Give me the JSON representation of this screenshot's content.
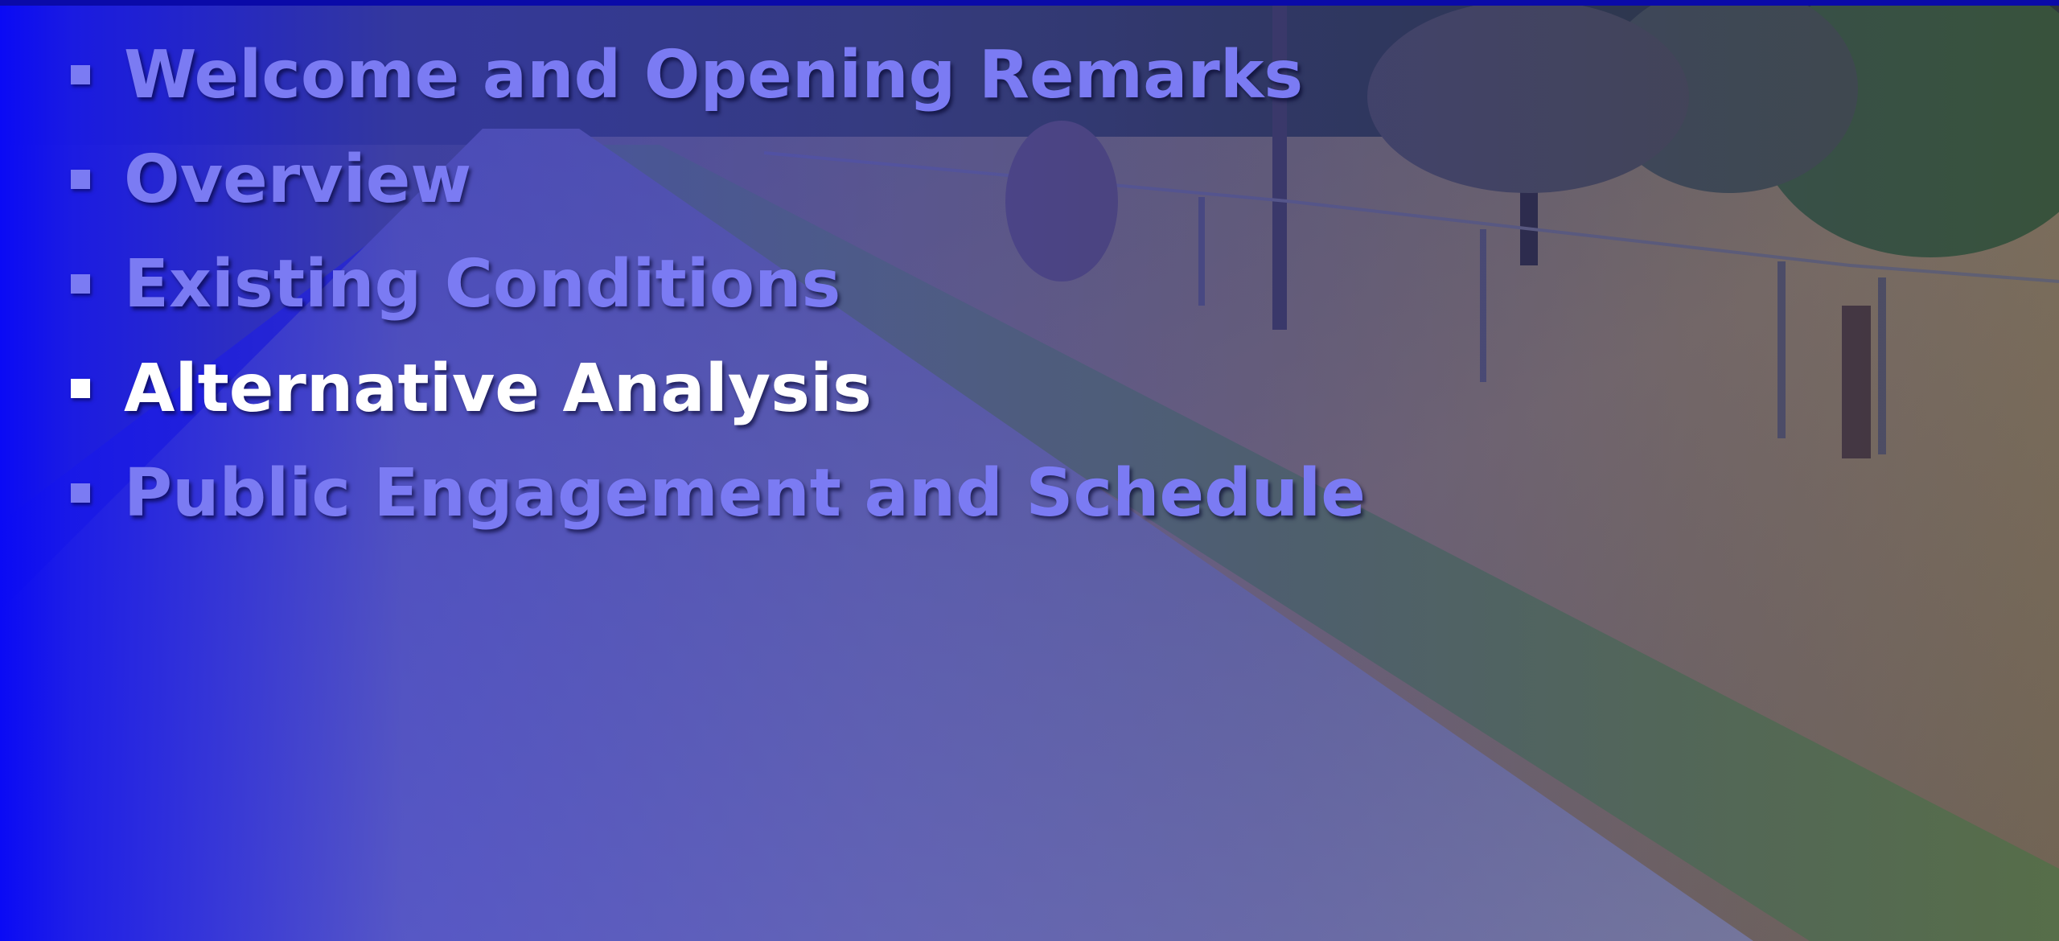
{
  "agenda": {
    "items": [
      {
        "label": "Welcome and Opening Remarks",
        "active": false
      },
      {
        "label": "Overview",
        "active": false
      },
      {
        "label": "Existing Conditions",
        "active": false
      },
      {
        "label": "Alternative Analysis",
        "active": true
      },
      {
        "label": "Public Engagement and Schedule",
        "active": false
      }
    ],
    "active_color": "#ffffff",
    "inactive_color": "#7b7bf3"
  },
  "background": {
    "overlay_color": "#2020e0",
    "bullet": "square-bullet-icon"
  }
}
